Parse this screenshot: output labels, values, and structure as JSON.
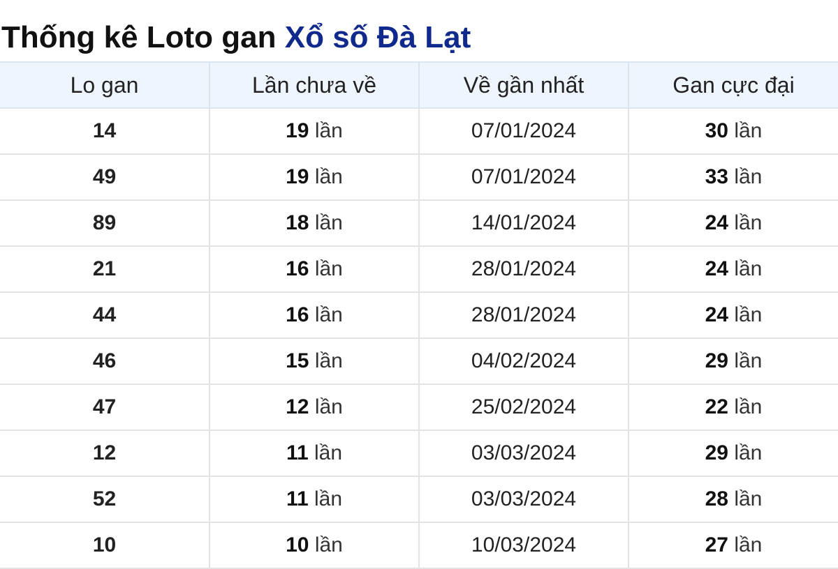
{
  "title": {
    "prefix": "Thống kê Loto gan",
    "accent": "Xổ số Đà Lạt"
  },
  "colors": {
    "accent": "#0f2a8c",
    "date_text": "#1f3690",
    "header_bg": "#eef5fd"
  },
  "table": {
    "headers": [
      "Lo gan",
      "Lần chưa về",
      "Về gần nhất",
      "Gan cực đại"
    ],
    "unit": "lần",
    "rows": [
      {
        "lo": "14",
        "chua_ve": "19",
        "gan_nhat": "07/01/2024",
        "cuc_dai": "30"
      },
      {
        "lo": "49",
        "chua_ve": "19",
        "gan_nhat": "07/01/2024",
        "cuc_dai": "33"
      },
      {
        "lo": "89",
        "chua_ve": "18",
        "gan_nhat": "14/01/2024",
        "cuc_dai": "24"
      },
      {
        "lo": "21",
        "chua_ve": "16",
        "gan_nhat": "28/01/2024",
        "cuc_dai": "24"
      },
      {
        "lo": "44",
        "chua_ve": "16",
        "gan_nhat": "28/01/2024",
        "cuc_dai": "24"
      },
      {
        "lo": "46",
        "chua_ve": "15",
        "gan_nhat": "04/02/2024",
        "cuc_dai": "29"
      },
      {
        "lo": "47",
        "chua_ve": "12",
        "gan_nhat": "25/02/2024",
        "cuc_dai": "22"
      },
      {
        "lo": "12",
        "chua_ve": "11",
        "gan_nhat": "03/03/2024",
        "cuc_dai": "29"
      },
      {
        "lo": "52",
        "chua_ve": "11",
        "gan_nhat": "03/03/2024",
        "cuc_dai": "28"
      },
      {
        "lo": "10",
        "chua_ve": "10",
        "gan_nhat": "10/03/2024",
        "cuc_dai": "27"
      }
    ]
  }
}
